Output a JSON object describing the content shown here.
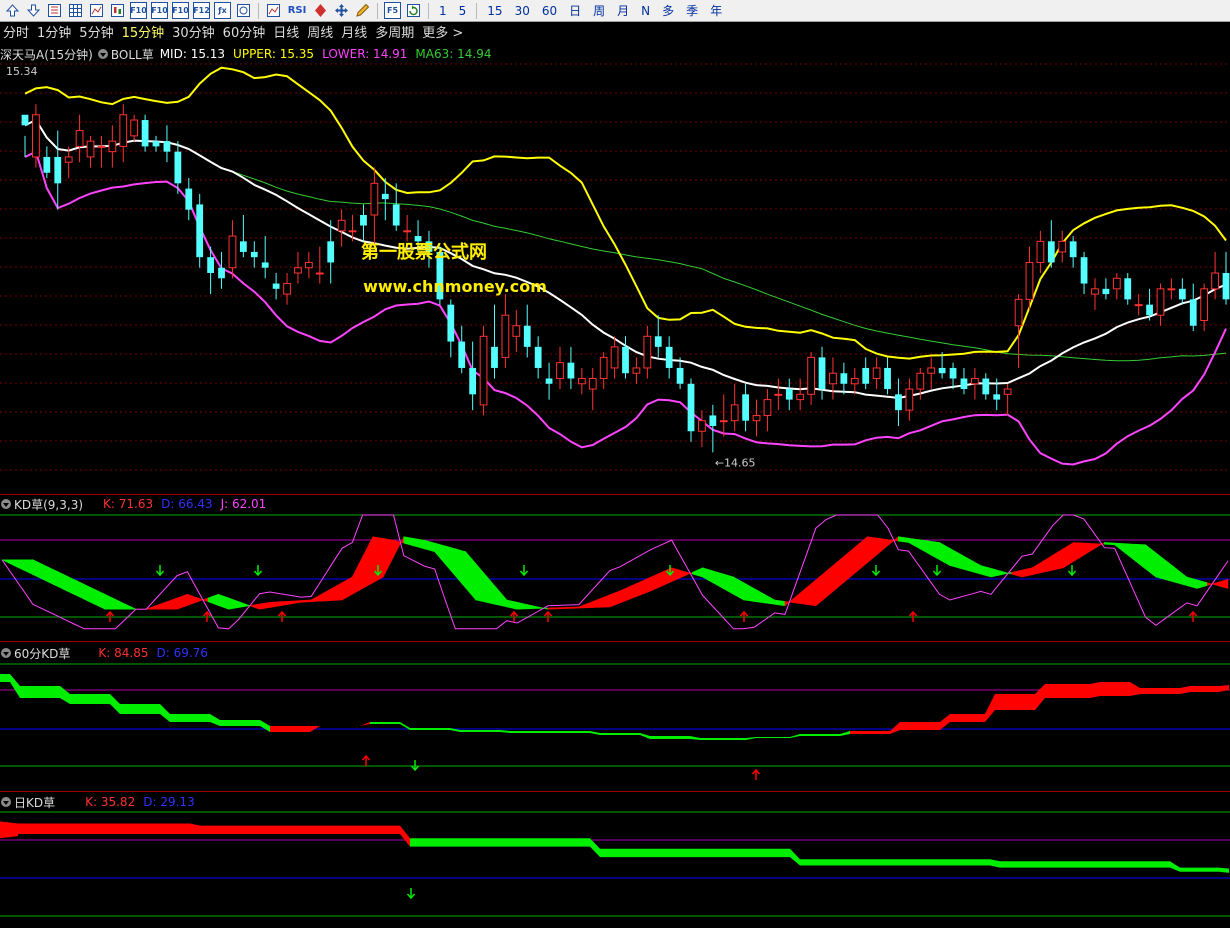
{
  "toolbar": {
    "icons": [
      "arrow-up-icon",
      "arrow-down-icon",
      "grid-icon",
      "table-icon",
      "line-chart-icon",
      "candle-icon",
      "f10-icon",
      "f10-alt-icon",
      "f10-page-icon",
      "f12-icon",
      "fx-formula-icon",
      "circle-icon",
      "line-chart-icon",
      "rsi-icon",
      "diamond-icon",
      "move-icon",
      "pencil-icon",
      "f5-icon",
      "refresh-icon"
    ],
    "rsi_label": "RSI",
    "f10": "F10",
    "f12": "F12",
    "f5": "F5",
    "nums": [
      "1",
      "5",
      "15",
      "30",
      "60",
      "日",
      "周",
      "月",
      "N",
      "多",
      "季",
      "年"
    ]
  },
  "periods": [
    "分时",
    "1分钟",
    "5分钟",
    "15分钟",
    "30分钟",
    "60分钟",
    "日线",
    "周线",
    "月线",
    "多周期",
    "更多 >"
  ],
  "active_period": "15分钟",
  "colors": {
    "bg": "#000000",
    "up": "#ff3232",
    "down": "#54ffff",
    "mid": "#ffffff",
    "upper": "#ffff00",
    "lower": "#ff44ff",
    "ma63": "#33cc33",
    "kdred": "#ff0000",
    "kdgreen": "#00ee00",
    "jline": "#ff44ff",
    "grid": "#7a0000",
    "hline_green": "#00aa00",
    "hline_blue": "#0000ff",
    "hline_magenta": "#aa00aa"
  },
  "main": {
    "stock_name": "深天马A",
    "period": "(15分钟)",
    "indicator": "BOLL草",
    "mid_label": "MID: 15.13",
    "upper_label": "UPPER: 15.35",
    "lower_label": "LOWER: 14.91",
    "ma_label": "MA63: 14.94",
    "high_marker": "15.34",
    "low_marker": "←14.65",
    "watermark_cn": "第一股票公式网",
    "watermark_url": "www.chnmoney.com"
  },
  "kd": {
    "name": "KD草(9,3,3)",
    "k": "K: 71.63",
    "d": "D: 66.43",
    "j": "J: 62.01"
  },
  "kd60": {
    "name": "60分KD草",
    "k": "K: 84.85",
    "d": "D: 69.76"
  },
  "kdday": {
    "name": "日KD草",
    "k": "K: 35.82",
    "d": "D: 29.13"
  },
  "chart_data": [
    {
      "type": "candlestick",
      "title": "BOLL草",
      "ylim": [
        14.6,
        15.4
      ],
      "candles": [
        [
          15.3,
          15.26,
          15.22,
          15.28
        ],
        [
          15.22,
          15.32,
          15.2,
          15.3
        ],
        [
          15.22,
          15.24,
          15.18,
          15.19
        ],
        [
          15.22,
          15.27,
          15.12,
          15.17
        ],
        [
          15.21,
          15.24,
          15.18,
          15.22
        ],
        [
          15.24,
          15.3,
          15.21,
          15.27
        ],
        [
          15.22,
          15.26,
          15.2,
          15.25
        ],
        [
          15.24,
          15.26,
          15.2,
          15.24
        ],
        [
          15.23,
          15.28,
          15.2,
          15.25
        ],
        [
          15.24,
          15.32,
          15.21,
          15.3
        ],
        [
          15.26,
          15.3,
          15.25,
          15.29
        ],
        [
          15.29,
          15.3,
          15.23,
          15.24
        ],
        [
          15.25,
          15.26,
          15.23,
          15.24
        ],
        [
          15.25,
          15.28,
          15.21,
          15.23
        ],
        [
          15.23,
          15.25,
          15.15,
          15.17
        ],
        [
          15.16,
          15.18,
          15.1,
          15.12
        ],
        [
          15.13,
          15.15,
          15.01,
          15.03
        ],
        [
          15.03,
          15.05,
          14.96,
          15.0
        ],
        [
          15.01,
          15.04,
          14.97,
          14.99
        ],
        [
          15.01,
          15.1,
          14.99,
          15.07
        ],
        [
          15.06,
          15.11,
          15.03,
          15.04
        ],
        [
          15.04,
          15.06,
          15.01,
          15.03
        ],
        [
          15.02,
          15.07,
          14.99,
          15.01
        ],
        [
          14.98,
          15.0,
          14.95,
          14.97
        ],
        [
          14.96,
          15.0,
          14.94,
          14.98
        ],
        [
          15.0,
          15.04,
          14.98,
          15.01
        ],
        [
          15.01,
          15.04,
          14.99,
          15.02
        ],
        [
          15.0,
          15.05,
          14.98,
          15.0
        ],
        [
          15.06,
          15.1,
          14.98,
          15.02
        ],
        [
          15.08,
          15.12,
          15.05,
          15.1
        ],
        [
          15.08,
          15.11,
          15.06,
          15.08
        ],
        [
          15.11,
          15.13,
          15.06,
          15.09
        ],
        [
          15.11,
          15.2,
          15.05,
          15.17
        ],
        [
          15.15,
          15.18,
          15.1,
          15.14
        ],
        [
          15.13,
          15.17,
          15.08,
          15.09
        ],
        [
          15.08,
          15.11,
          15.06,
          15.08
        ],
        [
          15.07,
          15.1,
          15.04,
          15.06
        ],
        [
          15.06,
          15.08,
          15.01,
          15.04
        ],
        [
          15.04,
          15.05,
          14.94,
          14.95
        ],
        [
          14.94,
          14.95,
          14.84,
          14.87
        ],
        [
          14.87,
          14.9,
          14.81,
          14.82
        ],
        [
          14.82,
          14.87,
          14.74,
          14.77
        ],
        [
          14.75,
          14.9,
          14.73,
          14.88
        ],
        [
          14.86,
          14.94,
          14.8,
          14.82
        ],
        [
          14.84,
          14.96,
          14.82,
          14.92
        ],
        [
          14.88,
          14.93,
          14.85,
          14.9
        ],
        [
          14.9,
          14.94,
          14.84,
          14.86
        ],
        [
          14.86,
          14.88,
          14.8,
          14.82
        ],
        [
          14.8,
          14.83,
          14.76,
          14.79
        ],
        [
          14.8,
          14.86,
          14.78,
          14.83
        ],
        [
          14.83,
          14.86,
          14.78,
          14.8
        ],
        [
          14.79,
          14.82,
          14.77,
          14.8
        ],
        [
          14.78,
          14.82,
          14.74,
          14.8
        ],
        [
          14.8,
          14.85,
          14.78,
          14.84
        ],
        [
          14.82,
          14.88,
          14.8,
          14.86
        ],
        [
          14.86,
          14.88,
          14.8,
          14.81
        ],
        [
          14.81,
          14.84,
          14.79,
          14.82
        ],
        [
          14.82,
          14.9,
          14.8,
          14.88
        ],
        [
          14.88,
          14.92,
          14.84,
          14.86
        ],
        [
          14.86,
          14.88,
          14.8,
          14.82
        ],
        [
          14.82,
          14.84,
          14.78,
          14.79
        ],
        [
          14.79,
          14.8,
          14.68,
          14.7
        ],
        [
          14.7,
          14.74,
          14.67,
          14.72
        ],
        [
          14.73,
          14.75,
          14.66,
          14.71
        ],
        [
          14.72,
          14.77,
          14.69,
          14.72
        ],
        [
          14.72,
          14.79,
          14.7,
          14.75
        ],
        [
          14.77,
          14.79,
          14.7,
          14.72
        ],
        [
          14.72,
          14.76,
          14.69,
          14.73
        ],
        [
          14.73,
          14.78,
          14.7,
          14.76
        ],
        [
          14.77,
          14.8,
          14.74,
          14.77
        ],
        [
          14.78,
          14.8,
          14.74,
          14.76
        ],
        [
          14.76,
          14.8,
          14.74,
          14.77
        ],
        [
          14.77,
          14.85,
          14.75,
          14.84
        ],
        [
          14.84,
          14.86,
          14.76,
          14.78
        ],
        [
          14.79,
          14.84,
          14.76,
          14.81
        ],
        [
          14.81,
          14.83,
          14.77,
          14.79
        ],
        [
          14.79,
          14.82,
          14.77,
          14.8
        ],
        [
          14.82,
          14.84,
          14.78,
          14.79
        ],
        [
          14.8,
          14.84,
          14.78,
          14.82
        ],
        [
          14.82,
          14.84,
          14.77,
          14.78
        ],
        [
          14.77,
          14.8,
          14.71,
          14.74
        ],
        [
          14.74,
          14.8,
          14.72,
          14.78
        ],
        [
          14.78,
          14.82,
          14.76,
          14.81
        ],
        [
          14.81,
          14.84,
          14.78,
          14.82
        ],
        [
          14.82,
          14.85,
          14.8,
          14.81
        ],
        [
          14.82,
          14.83,
          14.78,
          14.8
        ],
        [
          14.8,
          14.82,
          14.77,
          14.78
        ],
        [
          14.79,
          14.82,
          14.76,
          14.8
        ],
        [
          14.8,
          14.81,
          14.76,
          14.77
        ],
        [
          14.77,
          14.8,
          14.74,
          14.76
        ],
        [
          14.77,
          14.79,
          14.73,
          14.78
        ],
        [
          14.9,
          14.96,
          14.82,
          14.95
        ],
        [
          14.95,
          15.05,
          14.93,
          15.02
        ],
        [
          15.02,
          15.08,
          15.0,
          15.06
        ],
        [
          15.06,
          15.1,
          15.01,
          15.02
        ],
        [
          15.04,
          15.08,
          15.02,
          15.06
        ],
        [
          15.06,
          15.07,
          15.01,
          15.03
        ],
        [
          15.03,
          15.04,
          14.96,
          14.98
        ],
        [
          14.96,
          14.99,
          14.93,
          14.97
        ],
        [
          14.97,
          14.99,
          14.95,
          14.96
        ],
        [
          14.97,
          15.0,
          14.95,
          14.99
        ],
        [
          14.99,
          15.0,
          14.94,
          14.95
        ],
        [
          14.94,
          14.96,
          14.92,
          14.94
        ],
        [
          14.94,
          14.97,
          14.91,
          14.92
        ],
        [
          14.92,
          14.98,
          14.9,
          14.97
        ],
        [
          14.97,
          14.99,
          14.95,
          14.97
        ],
        [
          14.97,
          14.99,
          14.94,
          14.95
        ],
        [
          14.95,
          14.98,
          14.89,
          14.9
        ],
        [
          14.91,
          14.98,
          14.89,
          14.97
        ],
        [
          14.97,
          15.04,
          14.95,
          15.0
        ],
        [
          15.0,
          15.04,
          14.94,
          14.95
        ]
      ]
    }
  ]
}
